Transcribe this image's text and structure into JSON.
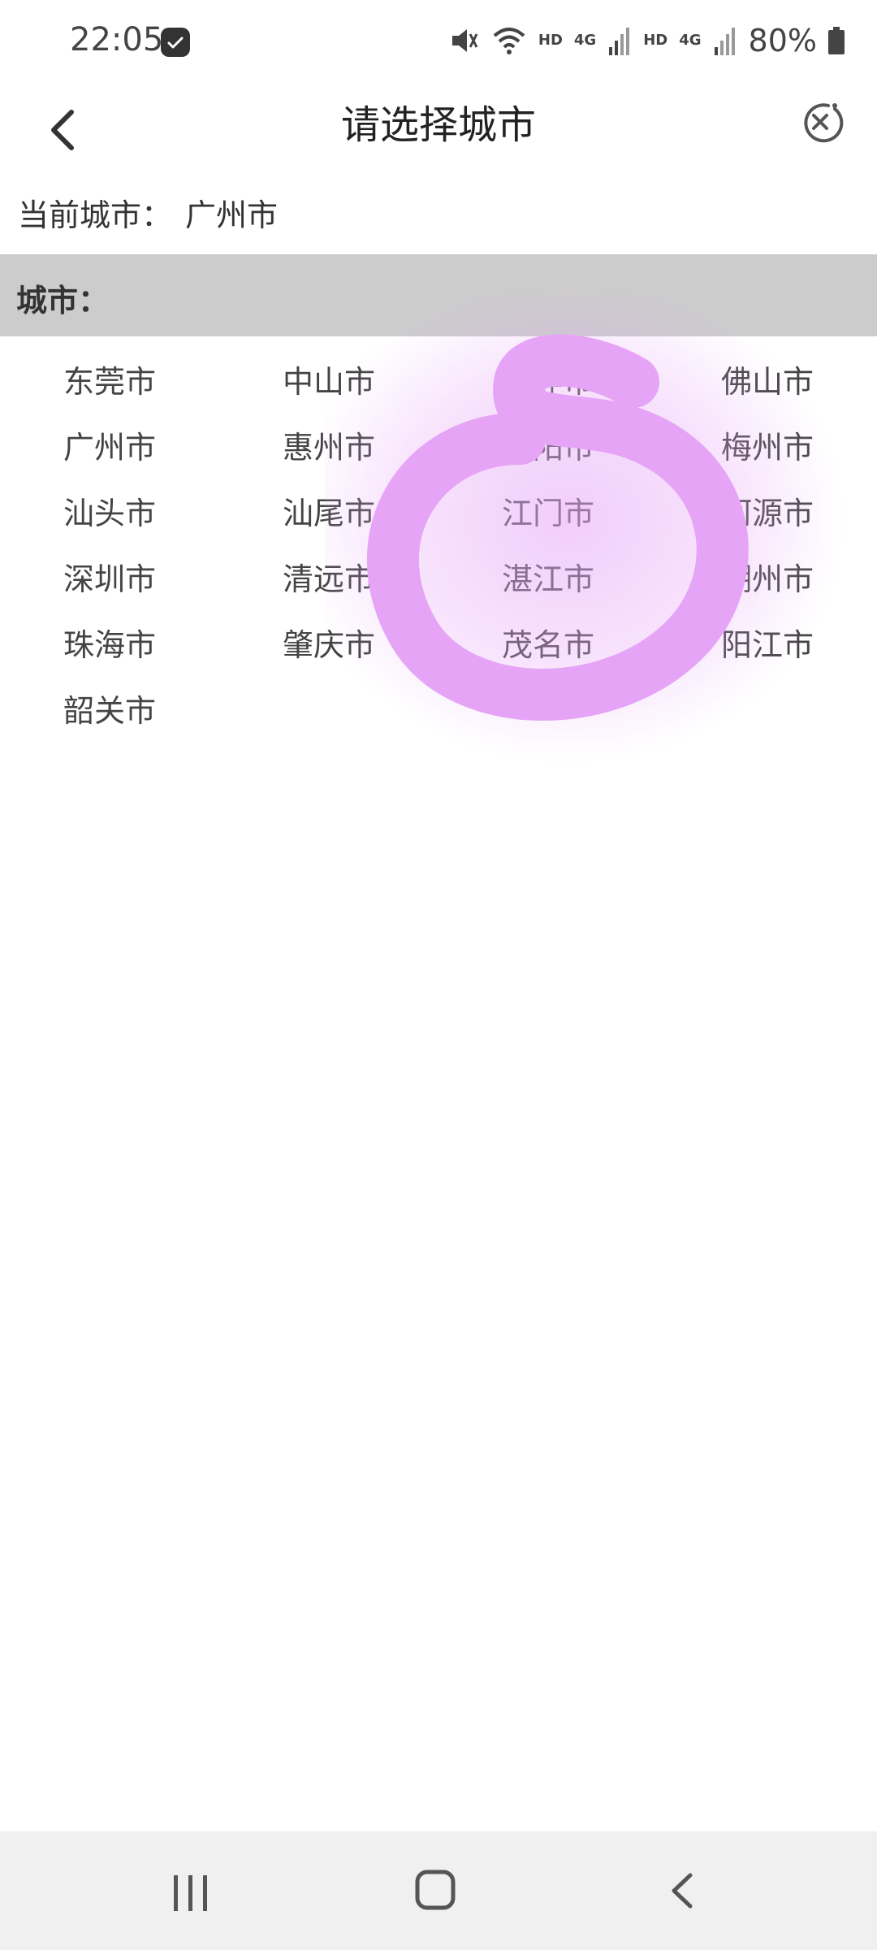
{
  "status_bar": {
    "time": "22:05",
    "hd1": "HD",
    "net1": "4G",
    "hd2": "HD",
    "net2": "4G",
    "battery": "80%"
  },
  "header": {
    "title": "请选择城市",
    "back_icon": "chevron-left-icon",
    "close_icon": "close-circle-icon"
  },
  "current_city": {
    "label": "当前城市：",
    "value": "广州市"
  },
  "section": {
    "title": "城市："
  },
  "cities": [
    [
      "东莞市",
      "中山市",
      "云浮市",
      "佛山市"
    ],
    [
      "广州市",
      "惠州市",
      "揭阳市",
      "梅州市"
    ],
    [
      "汕头市",
      "汕尾市",
      "江门市",
      "河源市"
    ],
    [
      "深圳市",
      "清远市",
      "湛江市",
      "潮州市"
    ],
    [
      "珠海市",
      "肇庆市",
      "茂名市",
      "阳江市"
    ],
    [
      "韶关市"
    ]
  ],
  "colors": {
    "section_bg": "#cccccc",
    "scribble": "#e6a4f7"
  }
}
